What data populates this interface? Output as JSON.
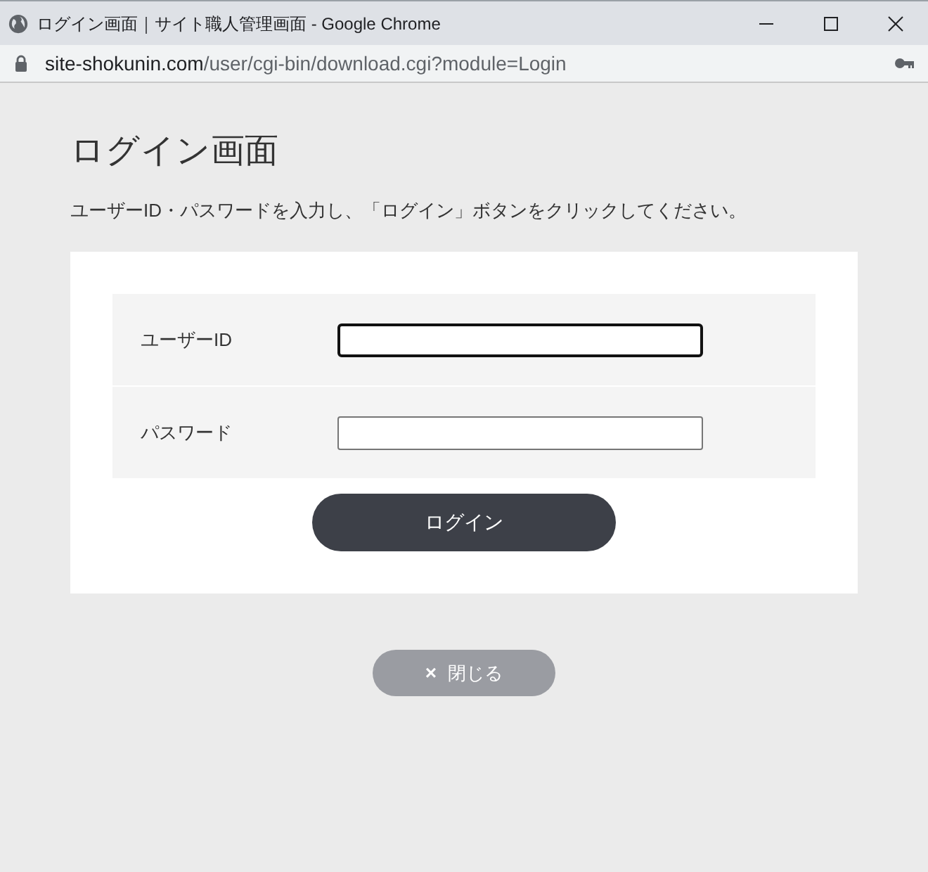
{
  "window": {
    "title": "ログイン画面｜サイト職人管理画面 - Google Chrome"
  },
  "address_bar": {
    "host": "site-shokunin.com",
    "path": "/user/cgi-bin/download.cgi?module=Login"
  },
  "heading": "ログイン画面",
  "instruction": "ユーザーID・パスワードを入力し、「ログイン」ボタンをクリックしてください。",
  "fields": [
    {
      "label": "ユーザーID",
      "focused": true
    },
    {
      "label": "パスワード",
      "focused": false
    }
  ],
  "login_button": "ログイン",
  "close_button": {
    "icon": "×",
    "label": "閉じる"
  }
}
